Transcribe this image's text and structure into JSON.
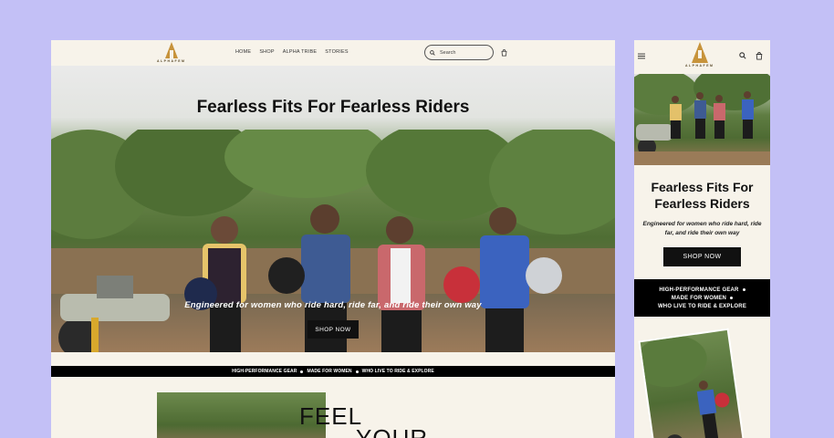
{
  "brand": {
    "name": "ALPHAFEM",
    "accent": "#c7933b"
  },
  "desktop": {
    "nav": [
      "HOME",
      "SHOP",
      "ALPHA TRIBE",
      "STORIES"
    ],
    "search": {
      "placeholder": "Search"
    },
    "hero": {
      "title": "Fearless Fits For Fearless Riders",
      "tagline": "Engineered for women who ride hard, ride far, and ride their own way",
      "cta": "SHOP NOW"
    },
    "strip": [
      "HIGH-PERFORMANCE GEAR",
      "MADE FOR WOMEN",
      "WHO LIVE TO RIDE & EXPLORE"
    ],
    "section2": {
      "line1": "FEEL",
      "line2": "YOUR"
    }
  },
  "mobile": {
    "hero": {
      "title": "Fearless Fits For Fearless Riders",
      "tagline": "Engineered for women who ride hard, ride far, and ride their own way",
      "cta": "SHOP NOW"
    },
    "strip": [
      "HIGH-PERFORMANCE GEAR",
      "MADE FOR WOMEN",
      "WHO LIVE TO RIDE & EXPLORE"
    ]
  },
  "colors": {
    "background": "#c3c0f6",
    "page": "#f7f3ea",
    "strip": "#000000"
  }
}
